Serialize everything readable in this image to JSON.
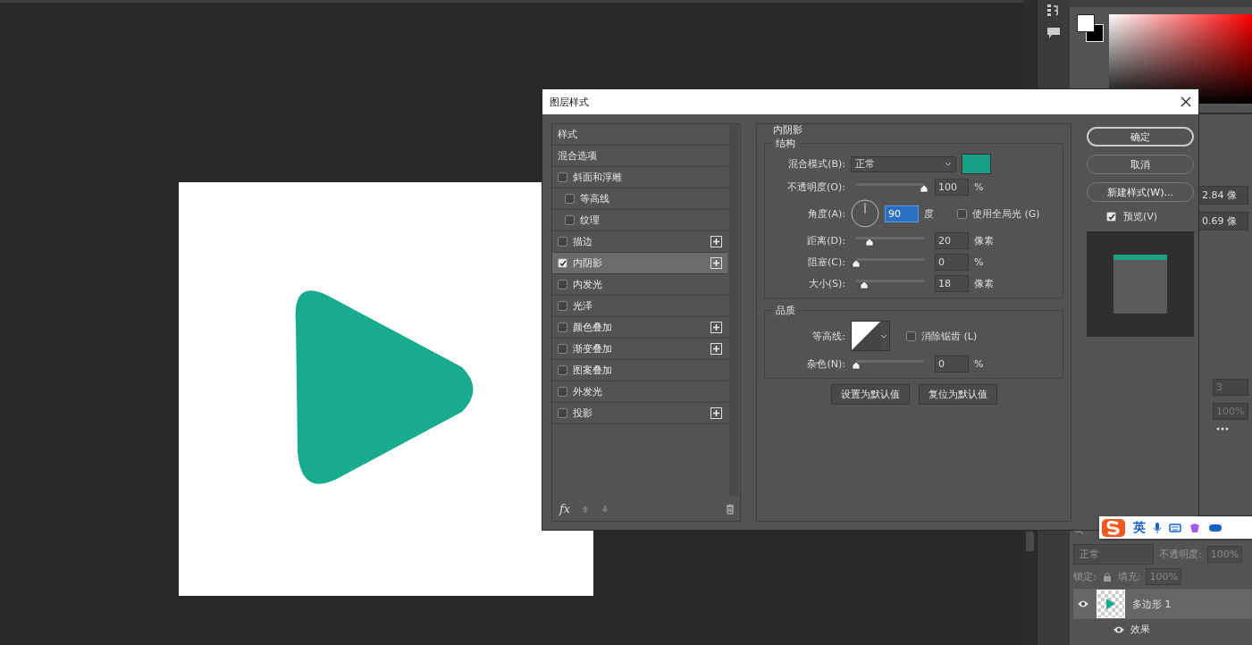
{
  "dialog": {
    "title": "图层样式",
    "styles_list": {
      "header": "样式",
      "blend_options": "混合选项",
      "fx": "fx",
      "effects": [
        {
          "label": "斜面和浮雕",
          "checked": false,
          "selected": false,
          "addable": false,
          "children": [
            {
              "label": "等高线",
              "checked": false,
              "selected": false,
              "addable": false
            },
            {
              "label": "纹理",
              "checked": false,
              "selected": false,
              "addable": false
            }
          ]
        },
        {
          "label": "描边",
          "checked": false,
          "selected": false,
          "addable": true
        },
        {
          "label": "内阴影",
          "checked": true,
          "selected": true,
          "addable": true
        },
        {
          "label": "内发光",
          "checked": false,
          "selected": false,
          "addable": false
        },
        {
          "label": "光泽",
          "checked": false,
          "selected": false,
          "addable": false
        },
        {
          "label": "颜色叠加",
          "checked": false,
          "selected": false,
          "addable": true
        },
        {
          "label": "渐变叠加",
          "checked": false,
          "selected": false,
          "addable": true
        },
        {
          "label": "图案叠加",
          "checked": false,
          "selected": false,
          "addable": false
        },
        {
          "label": "外发光",
          "checked": false,
          "selected": false,
          "addable": false
        },
        {
          "label": "投影",
          "checked": false,
          "selected": false,
          "addable": true
        }
      ]
    },
    "settings": {
      "title": "内阴影",
      "structure": {
        "title": "结构",
        "blend_mode": {
          "label": "混合模式(B):",
          "value": "正常",
          "color": "#17a086"
        },
        "rows": [
          {
            "kind": "slider",
            "label": "不透明度(O):",
            "level": 1,
            "value": "100",
            "unit": "%"
          },
          {
            "kind": "angle",
            "label": "角度(A):",
            "value": "90",
            "unit": "度",
            "focused": true,
            "global_light": {
              "label": "使用全局光 (G)",
              "checked": false
            }
          },
          {
            "kind": "slider",
            "label": "距离(D):",
            "level": 0.2,
            "value": "20",
            "unit": "像素"
          },
          {
            "kind": "slider",
            "label": "阻塞(C):",
            "level": 0,
            "value": "0",
            "unit": "%"
          },
          {
            "kind": "slider",
            "label": "大小(S):",
            "level": 0.12,
            "value": "18",
            "unit": "像素"
          }
        ]
      },
      "quality": {
        "title": "品质",
        "contour_label": "等高线:",
        "anti_alias": {
          "label": "消除锯齿 (L)",
          "checked": false
        },
        "noise": {
          "label": "杂色(N):",
          "level": 0,
          "value": "0",
          "unit": "%"
        }
      },
      "buttons": [
        "设置为默认值",
        "复位为默认值"
      ]
    },
    "actions": [
      {
        "label": "确定",
        "default": true
      },
      {
        "label": "取消",
        "default": false
      },
      {
        "label": "新建样式(W)...",
        "default": false
      }
    ],
    "preview": {
      "label": "预览(V)",
      "checked": true
    }
  },
  "properties": {
    "fields": [
      "2.84 像",
      "0.69 像"
    ],
    "disabled_fields": [
      "3",
      "100%"
    ]
  },
  "layers": {
    "blend_mode": "正常",
    "opacity_label": "不透明度:",
    "opacity": "100%",
    "lock_label": "锁定:",
    "fill_label": "填充:",
    "fill": "100%",
    "items": [
      {
        "name": "多边形 1",
        "selected": true,
        "effects_label": "效果"
      }
    ]
  },
  "ime": {
    "mode": "英"
  }
}
